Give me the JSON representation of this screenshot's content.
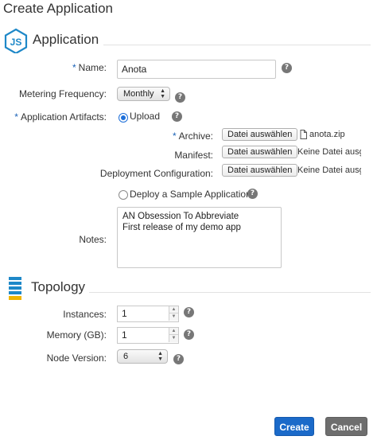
{
  "page": {
    "title": "Create Application"
  },
  "application_section": {
    "title": "Application",
    "name": {
      "label": "Name:",
      "value": "Anota"
    },
    "metering": {
      "label": "Metering Frequency:",
      "selected": "Monthly"
    },
    "artifacts": {
      "label": "Application Artifacts:",
      "upload_label": "Upload",
      "archive": {
        "label": "Archive:",
        "button": "Datei auswählen",
        "status": "anota.zip"
      },
      "manifest": {
        "label": "Manifest:",
        "button": "Datei auswählen",
        "status": "Keine Datei ausg"
      },
      "deployment": {
        "label": "Deployment Configuration:",
        "button": "Datei auswählen",
        "status": "Keine Datei ausg"
      },
      "sample_label": "Deploy a Sample Application"
    },
    "notes": {
      "label": "Notes:",
      "value": "AN Obsession To Abbreviate\nFirst release of my demo app"
    }
  },
  "topology_section": {
    "title": "Topology",
    "instances": {
      "label": "Instances:",
      "value": "1"
    },
    "memory": {
      "label": "Memory (GB):",
      "value": "1"
    },
    "node_version": {
      "label": "Node Version:",
      "selected": "6"
    }
  },
  "buttons": {
    "create": "Create",
    "cancel": "Cancel"
  },
  "icons": {
    "required_marker": "*",
    "help": "?",
    "select_arrows": "▲▼",
    "spinner_up": "▲",
    "spinner_down": "▼"
  },
  "colors": {
    "primary": "#1b6ac9",
    "secondary": "#6e6e6e",
    "required": "#1b62b7",
    "node_icon": "#1e88c8",
    "topology_icon": "#1e88c8"
  }
}
